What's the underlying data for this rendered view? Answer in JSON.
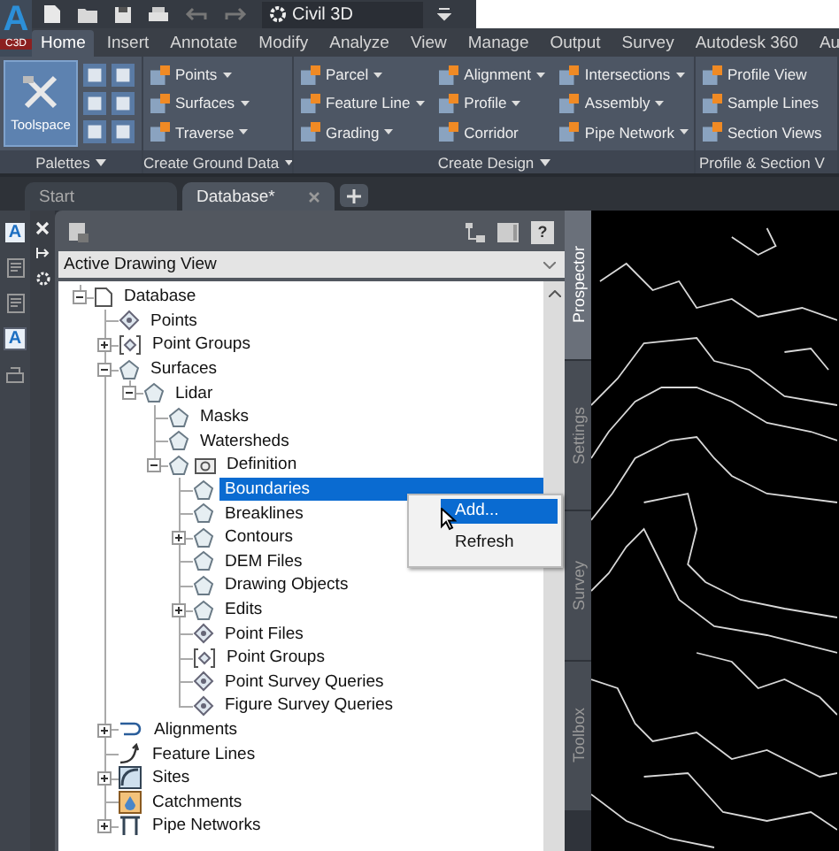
{
  "app_button": {
    "logo": "A",
    "label": "C3D"
  },
  "quick_access": {
    "workspace": "Civil 3D"
  },
  "ribbon_tabs": [
    {
      "label": "Home",
      "selected": true
    },
    {
      "label": "Insert",
      "selected": false
    },
    {
      "label": "Annotate",
      "selected": false
    },
    {
      "label": "Modify",
      "selected": false
    },
    {
      "label": "Analyze",
      "selected": false
    },
    {
      "label": "View",
      "selected": false
    },
    {
      "label": "Manage",
      "selected": false
    },
    {
      "label": "Output",
      "selected": false
    },
    {
      "label": "Survey",
      "selected": false
    },
    {
      "label": "Autodesk 360",
      "selected": false
    },
    {
      "label": "Au",
      "selected": false
    }
  ],
  "ribbon_panels": [
    {
      "title": "Palettes",
      "dropdown": true,
      "kind": "palettes",
      "big_button": {
        "label": "Toolspace",
        "selected": true
      }
    },
    {
      "title": "Create Ground Data",
      "dropdown": true,
      "kind": "tools",
      "columns": [
        [
          {
            "label": "Points",
            "dropdown": true
          },
          {
            "label": "Surfaces",
            "dropdown": true
          },
          {
            "label": "Traverse",
            "dropdown": true
          }
        ]
      ]
    },
    {
      "title": "Create Design",
      "dropdown": true,
      "kind": "tools",
      "columns": [
        [
          {
            "label": "Parcel",
            "dropdown": true
          },
          {
            "label": "Feature Line",
            "dropdown": true
          },
          {
            "label": "Grading",
            "dropdown": true
          }
        ],
        [
          {
            "label": "Alignment",
            "dropdown": true
          },
          {
            "label": "Profile",
            "dropdown": true
          },
          {
            "label": "Corridor",
            "dropdown": false
          }
        ],
        [
          {
            "label": "Intersections",
            "dropdown": true
          },
          {
            "label": "Assembly",
            "dropdown": true
          },
          {
            "label": "Pipe Network",
            "dropdown": true
          }
        ]
      ]
    },
    {
      "title": "Profile & Section V",
      "dropdown": false,
      "kind": "tools",
      "columns": [
        [
          {
            "label": "Profile View",
            "dropdown": false
          },
          {
            "label": "Sample Lines",
            "dropdown": false
          },
          {
            "label": "Section Views",
            "dropdown": false
          }
        ]
      ]
    }
  ],
  "document_tabs": [
    {
      "label": "Start",
      "selected": false,
      "closable": false
    },
    {
      "label": "Database*",
      "selected": true,
      "closable": true
    }
  ],
  "left_toolbar": [
    {
      "kind": "letter",
      "text": "A",
      "selected": false
    },
    {
      "kind": "list",
      "selected": false
    },
    {
      "kind": "list",
      "selected": false
    },
    {
      "kind": "letter",
      "text": "A",
      "selected": true
    },
    {
      "kind": "layers",
      "selected": false
    }
  ],
  "toolspace": {
    "help": "?",
    "view_selector": {
      "value": "Active Drawing View"
    },
    "tree": [
      {
        "label": "Database",
        "kind": "document",
        "expanded": true,
        "selected": false,
        "children": [
          {
            "label": "Points",
            "kind": "point",
            "selected": false
          },
          {
            "label": "Point Groups",
            "kind": "group",
            "expanded": false,
            "selected": false
          },
          {
            "label": "Surfaces",
            "kind": "surface",
            "expanded": true,
            "selected": false,
            "children": [
              {
                "label": "Lidar",
                "kind": "surface",
                "expanded": true,
                "selected": false,
                "children": [
                  {
                    "label": "Masks",
                    "kind": "surface",
                    "selected": false
                  },
                  {
                    "label": "Watersheds",
                    "kind": "surface",
                    "selected": false
                  },
                  {
                    "label": "Definition",
                    "kind": "definition",
                    "expanded": true,
                    "selected": false,
                    "children": [
                      {
                        "label": "Boundaries",
                        "kind": "surface",
                        "selected": true
                      },
                      {
                        "label": "Breaklines",
                        "kind": "surface",
                        "selected": false
                      },
                      {
                        "label": "Contours",
                        "kind": "surface",
                        "expanded": false,
                        "selected": false
                      },
                      {
                        "label": "DEM Files",
                        "kind": "surface",
                        "selected": false
                      },
                      {
                        "label": "Drawing Objects",
                        "kind": "surface",
                        "selected": false
                      },
                      {
                        "label": "Edits",
                        "kind": "surface",
                        "expanded": false,
                        "selected": false
                      },
                      {
                        "label": "Point Files",
                        "kind": "point",
                        "selected": false
                      },
                      {
                        "label": "Point Groups",
                        "kind": "group",
                        "selected": false
                      },
                      {
                        "label": "Point Survey Queries",
                        "kind": "point",
                        "selected": false
                      },
                      {
                        "label": "Figure Survey Queries",
                        "kind": "point",
                        "selected": false
                      }
                    ]
                  }
                ]
              }
            ]
          },
          {
            "label": "Alignments",
            "kind": "alignment",
            "expanded": false,
            "selected": false
          },
          {
            "label": "Feature Lines",
            "kind": "featureline",
            "selected": false
          },
          {
            "label": "Sites",
            "kind": "site",
            "expanded": false,
            "selected": false
          },
          {
            "label": "Catchments",
            "kind": "catchment",
            "selected": false
          },
          {
            "label": "Pipe Networks",
            "kind": "pipe",
            "expanded": false,
            "selected": false
          }
        ]
      }
    ],
    "context_menu": [
      {
        "label": "Add...",
        "selected": true
      },
      {
        "label": "Refresh",
        "selected": false
      }
    ],
    "side_tabs": [
      {
        "label": "Prospector",
        "selected": true
      },
      {
        "label": "Settings",
        "selected": false
      },
      {
        "label": "Survey",
        "selected": false
      },
      {
        "label": "Toolbox",
        "selected": false
      }
    ]
  }
}
